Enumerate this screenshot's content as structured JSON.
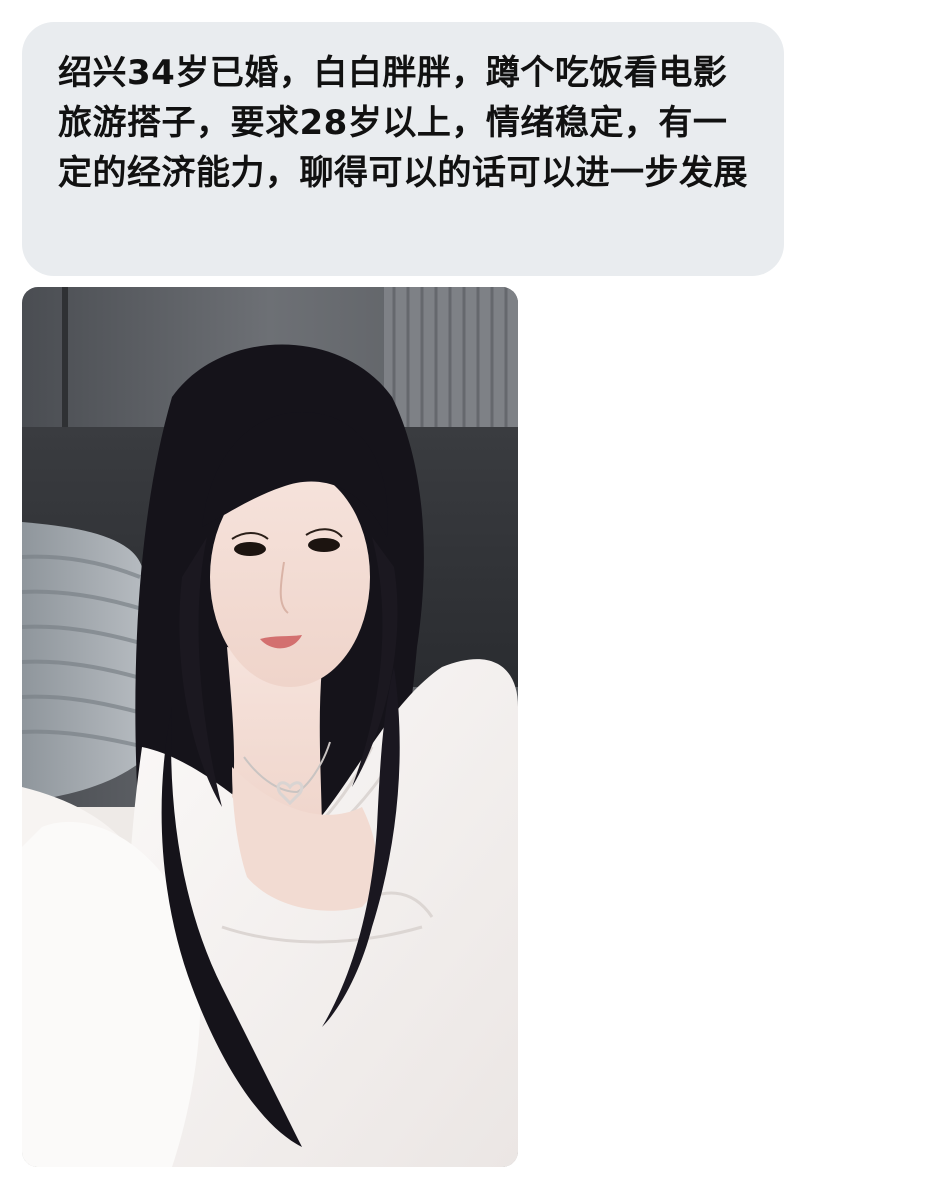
{
  "message": {
    "text": "绍兴34岁已婚，白白胖胖，蹲个吃饭看电影旅游搭子，要求28岁以上，情绪稳定，有一定的经济能力，聊得可以的话可以进一步发展"
  },
  "photo": {
    "subject": "selfie of a woman with long black hair in a white blouse with heart necklace"
  },
  "colors": {
    "bubble_background": "#e9ecef",
    "text": "#111111",
    "page_background": "#ffffff"
  }
}
